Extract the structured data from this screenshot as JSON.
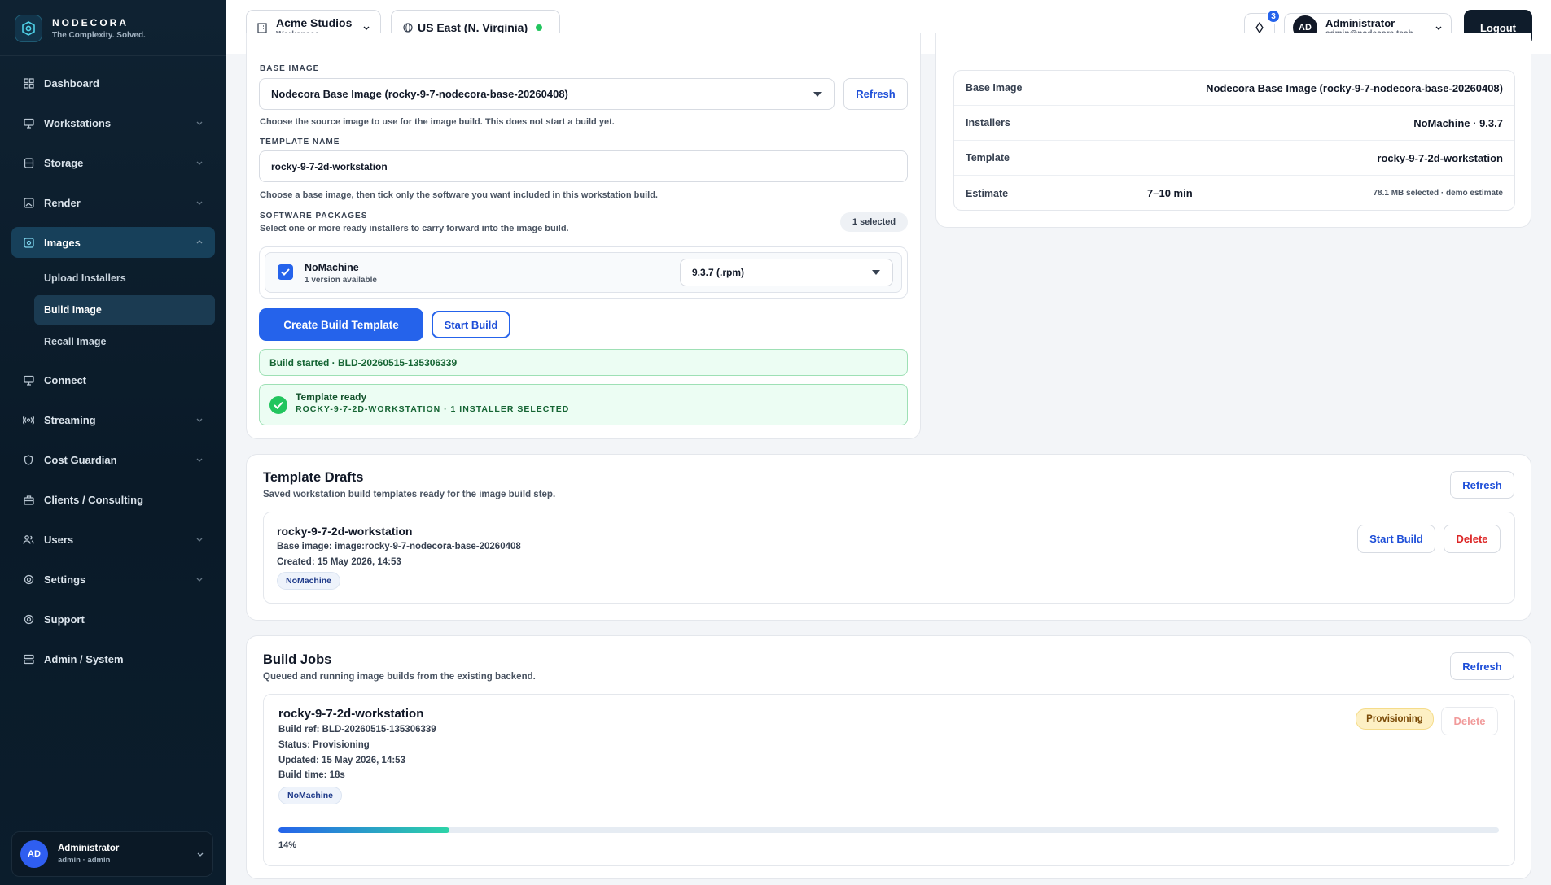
{
  "brand": {
    "name": "NODECORA",
    "tagline": "The Complexity. Solved."
  },
  "sidebar": {
    "items": [
      {
        "label": "Dashboard"
      },
      {
        "label": "Workstations"
      },
      {
        "label": "Storage"
      },
      {
        "label": "Render"
      },
      {
        "label": "Images"
      },
      {
        "label": "Connect"
      },
      {
        "label": "Streaming"
      },
      {
        "label": "Cost Guardian"
      },
      {
        "label": "Clients / Consulting"
      },
      {
        "label": "Users"
      },
      {
        "label": "Settings"
      },
      {
        "label": "Support"
      },
      {
        "label": "Admin / System"
      }
    ],
    "images_sub": [
      "Upload Installers",
      "Build Image",
      "Recall Image"
    ],
    "user": {
      "initials": "AD",
      "name": "Administrator",
      "role": "admin · admin"
    }
  },
  "topbar": {
    "workspace": {
      "name": "Acme Studios",
      "label": "Workspace"
    },
    "region": "US East (N. Virginia)",
    "notifications": "3",
    "account": {
      "initials": "AD",
      "name": "Administrator",
      "email": "admin@nodecora.tech"
    },
    "logout": "Logout"
  },
  "form": {
    "base_image_label": "BASE IMAGE",
    "base_image_value": "Nodecora Base Image (rocky-9-7-nodecora-base-20260408)",
    "refresh": "Refresh",
    "base_image_hint": "Choose the source image to use for the image build. This does not start a build yet.",
    "template_name_label": "TEMPLATE NAME",
    "template_name_value": "rocky-9-7-2d-workstation",
    "template_hint": "Choose a base image, then tick only the software you want included in this workstation build.",
    "software_label": "SOFTWARE PACKAGES",
    "software_hint": "Select one or more ready installers to carry forward into the image build.",
    "selected_count": "1 selected",
    "package": {
      "name": "NoMachine",
      "versions": "1 version available",
      "version_value": "9.3.7 (.rpm)"
    },
    "create_template": "Create Build Template",
    "start_build": "Start Build",
    "build_started": "Build started · BLD-20260515-135306339",
    "template_ready_title": "Template ready",
    "template_ready_sub": "ROCKY-9-7-2D-WORKSTATION · 1 INSTALLER SELECTED"
  },
  "summary": {
    "rows": [
      {
        "key": "Base Image",
        "value": "Nodecora Base Image (rocky-9-7-nodecora-base-20260408)"
      },
      {
        "key": "Installers",
        "value": "NoMachine · 9.3.7"
      },
      {
        "key": "Template",
        "value": "rocky-9-7-2d-workstation"
      },
      {
        "key": "Estimate",
        "value": "7–10 min",
        "note": "78.1 MB selected · demo estimate"
      }
    ]
  },
  "drafts": {
    "title": "Template Drafts",
    "subtitle": "Saved workstation build templates ready for the image build step.",
    "refresh": "Refresh",
    "item": {
      "name": "rocky-9-7-2d-workstation",
      "base": "Base image: image:rocky-9-7-nodecora-base-20260408",
      "created": "Created: 15 May 2026, 14:53",
      "tag": "NoMachine",
      "start": "Start Build",
      "delete": "Delete"
    }
  },
  "jobs": {
    "title": "Build Jobs",
    "subtitle": "Queued and running image builds from the existing backend.",
    "refresh": "Refresh",
    "item": {
      "name": "rocky-9-7-2d-workstation",
      "ref": "Build ref: BLD-20260515-135306339",
      "status": "Status: Provisioning",
      "updated": "Updated: 15 May 2026, 14:53",
      "build_time": "Build time: 18s",
      "tag": "NoMachine",
      "status_pill": "Provisioning",
      "delete": "Delete",
      "progress": 0.14,
      "progress_label": "14%"
    }
  }
}
